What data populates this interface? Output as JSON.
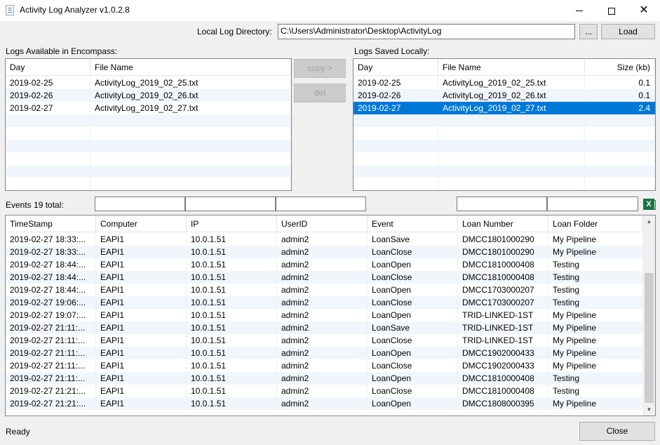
{
  "window": {
    "title": "Activity Log Analyzer v1.0.2.8",
    "minimize_glyph": "",
    "close_glyph": "✕"
  },
  "toolbar": {
    "local_dir_label": "Local Log Directory:",
    "local_dir_value": "C:\\Users\\Administrator\\Desktop\\ActivityLog",
    "browse_label": "...",
    "load_label": "Load"
  },
  "encompass": {
    "label": "Logs Available in Encompass:",
    "columns": [
      "Day",
      "File Name"
    ],
    "rows": [
      [
        "2019-02-25",
        "ActivityLog_2019_02_25.txt"
      ],
      [
        "2019-02-26",
        "ActivityLog_2019_02_26.txt"
      ],
      [
        "2019-02-27",
        "ActivityLog_2019_02_27.txt"
      ]
    ]
  },
  "actions": {
    "copy_label": "copy >",
    "del_label": "del"
  },
  "local": {
    "label": "Logs Saved Locally:",
    "columns": [
      "Day",
      "File Name",
      "Size (kb)"
    ],
    "rows": [
      [
        "2019-02-25",
        "ActivityLog_2019_02_25.txt",
        "0.1"
      ],
      [
        "2019-02-26",
        "ActivityLog_2019_02_26.txt",
        "0.1"
      ],
      [
        "2019-02-27",
        "ActivityLog_2019_02_27.txt",
        "2.4"
      ]
    ],
    "selected_index": 2
  },
  "events": {
    "count_label": "Events 19 total:",
    "filters": [
      "",
      "",
      "",
      "",
      ""
    ],
    "export_icon": "excel-icon",
    "columns": [
      "TimeStamp",
      "Computer",
      "IP",
      "UserID",
      "Event",
      "Loan Number",
      "Loan Folder"
    ],
    "rows": [
      [
        "2019-02-27 18:33:...",
        "EAPI1",
        "10.0.1.51",
        "admin2",
        "LoanSave",
        "DMCC1801000290",
        "My Pipeline"
      ],
      [
        "2019-02-27 18:33:...",
        "EAPI1",
        "10.0.1.51",
        "admin2",
        "LoanClose",
        "DMCC1801000290",
        "My Pipeline"
      ],
      [
        "2019-02-27 18:44:...",
        "EAPI1",
        "10.0.1.51",
        "admin2",
        "LoanOpen",
        "DMCC1810000408",
        "Testing"
      ],
      [
        "2019-02-27 18:44:...",
        "EAPI1",
        "10.0.1.51",
        "admin2",
        "LoanClose",
        "DMCC1810000408",
        "Testing"
      ],
      [
        "2019-02-27 18:44:...",
        "EAPI1",
        "10.0.1.51",
        "admin2",
        "LoanOpen",
        "DMCC1703000207",
        "Testing"
      ],
      [
        "2019-02-27 19:06:...",
        "EAPI1",
        "10.0.1.51",
        "admin2",
        "LoanClose",
        "DMCC1703000207",
        "Testing"
      ],
      [
        "2019-02-27 19:07:...",
        "EAPI1",
        "10.0.1.51",
        "admin2",
        "LoanOpen",
        "TRID-LINKED-1ST",
        "My Pipeline"
      ],
      [
        "2019-02-27 21:11:...",
        "EAPI1",
        "10.0.1.51",
        "admin2",
        "LoanSave",
        "TRID-LINKED-1ST",
        "My Pipeline"
      ],
      [
        "2019-02-27 21:11:...",
        "EAPI1",
        "10.0.1.51",
        "admin2",
        "LoanClose",
        "TRID-LINKED-1ST",
        "My Pipeline"
      ],
      [
        "2019-02-27 21:11:...",
        "EAPI1",
        "10.0.1.51",
        "admin2",
        "LoanOpen",
        "DMCC1902000433",
        "My Pipeline"
      ],
      [
        "2019-02-27 21:11:...",
        "EAPI1",
        "10.0.1.51",
        "admin2",
        "LoanClose",
        "DMCC1902000433",
        "My Pipeline"
      ],
      [
        "2019-02-27 21:11:...",
        "EAPI1",
        "10.0.1.51",
        "admin2",
        "LoanOpen",
        "DMCC1810000408",
        "Testing"
      ],
      [
        "2019-02-27 21:21:...",
        "EAPI1",
        "10.0.1.51",
        "admin2",
        "LoanClose",
        "DMCC1810000408",
        "Testing"
      ],
      [
        "2019-02-27 21:21:...",
        "EAPI1",
        "10.0.1.51",
        "admin2",
        "LoanOpen",
        "DMCC1808000395",
        "My Pipeline"
      ]
    ]
  },
  "status": {
    "text": "Ready",
    "close_label": "Close"
  },
  "colors": {
    "selection": "#0078d7",
    "alt_row": "#f1f6fd",
    "excel_green": "#1e7145"
  }
}
